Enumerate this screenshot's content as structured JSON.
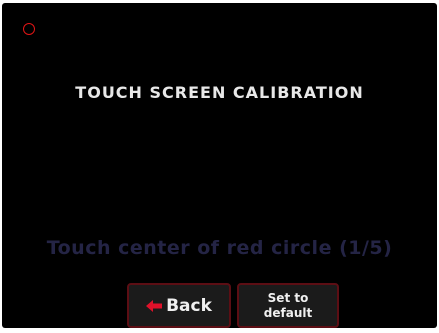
{
  "calibration": {
    "title": "TOUCH SCREEN CALIBRATION",
    "instruction": "Touch center of red circle (1/5)",
    "target_icon": "circle-outline",
    "target_color": "#e01515"
  },
  "buttons": {
    "back_label": "Back",
    "back_icon": "arrow-left",
    "default_line1": "Set to",
    "default_line2": "default"
  },
  "colors": {
    "background": "#000000",
    "button_border": "#5c0e14",
    "arrow": "#e0112a",
    "instruction_text": "#242445"
  }
}
